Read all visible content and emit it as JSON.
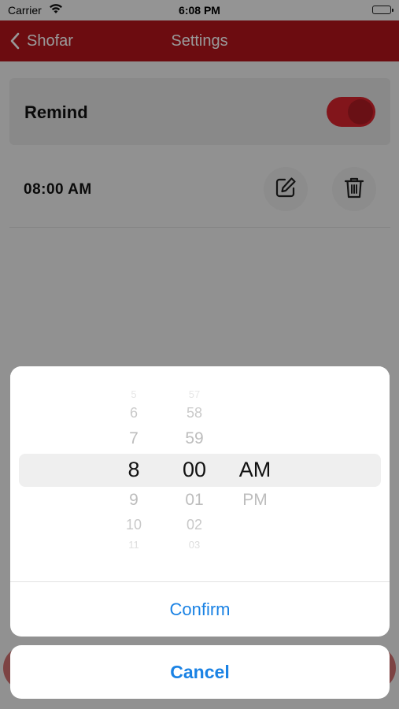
{
  "status_bar": {
    "carrier": "Carrier",
    "time": "6:08 PM",
    "wifi_icon": "wifi-icon",
    "battery_icon": "battery-icon"
  },
  "nav": {
    "back_label": "Shofar",
    "title": "Settings",
    "color": "#b4141c"
  },
  "settings": {
    "remind_label": "Remind",
    "remind_enabled": true,
    "alarm_time": "08:00 AM",
    "edit_icon": "edit-icon",
    "delete_icon": "trash-icon"
  },
  "picker": {
    "hours": {
      "above": [
        "5",
        "6",
        "7"
      ],
      "selected": "8",
      "below": [
        "9",
        "10",
        "11"
      ]
    },
    "minutes": {
      "above": [
        "57",
        "58",
        "59"
      ],
      "selected": "00",
      "below": [
        "01",
        "02",
        "03"
      ]
    },
    "period": {
      "selected": "AM",
      "below": [
        "PM"
      ]
    }
  },
  "actions": {
    "confirm_label": "Confirm",
    "cancel_label": "Cancel",
    "accent_color": "#1a82e4"
  }
}
